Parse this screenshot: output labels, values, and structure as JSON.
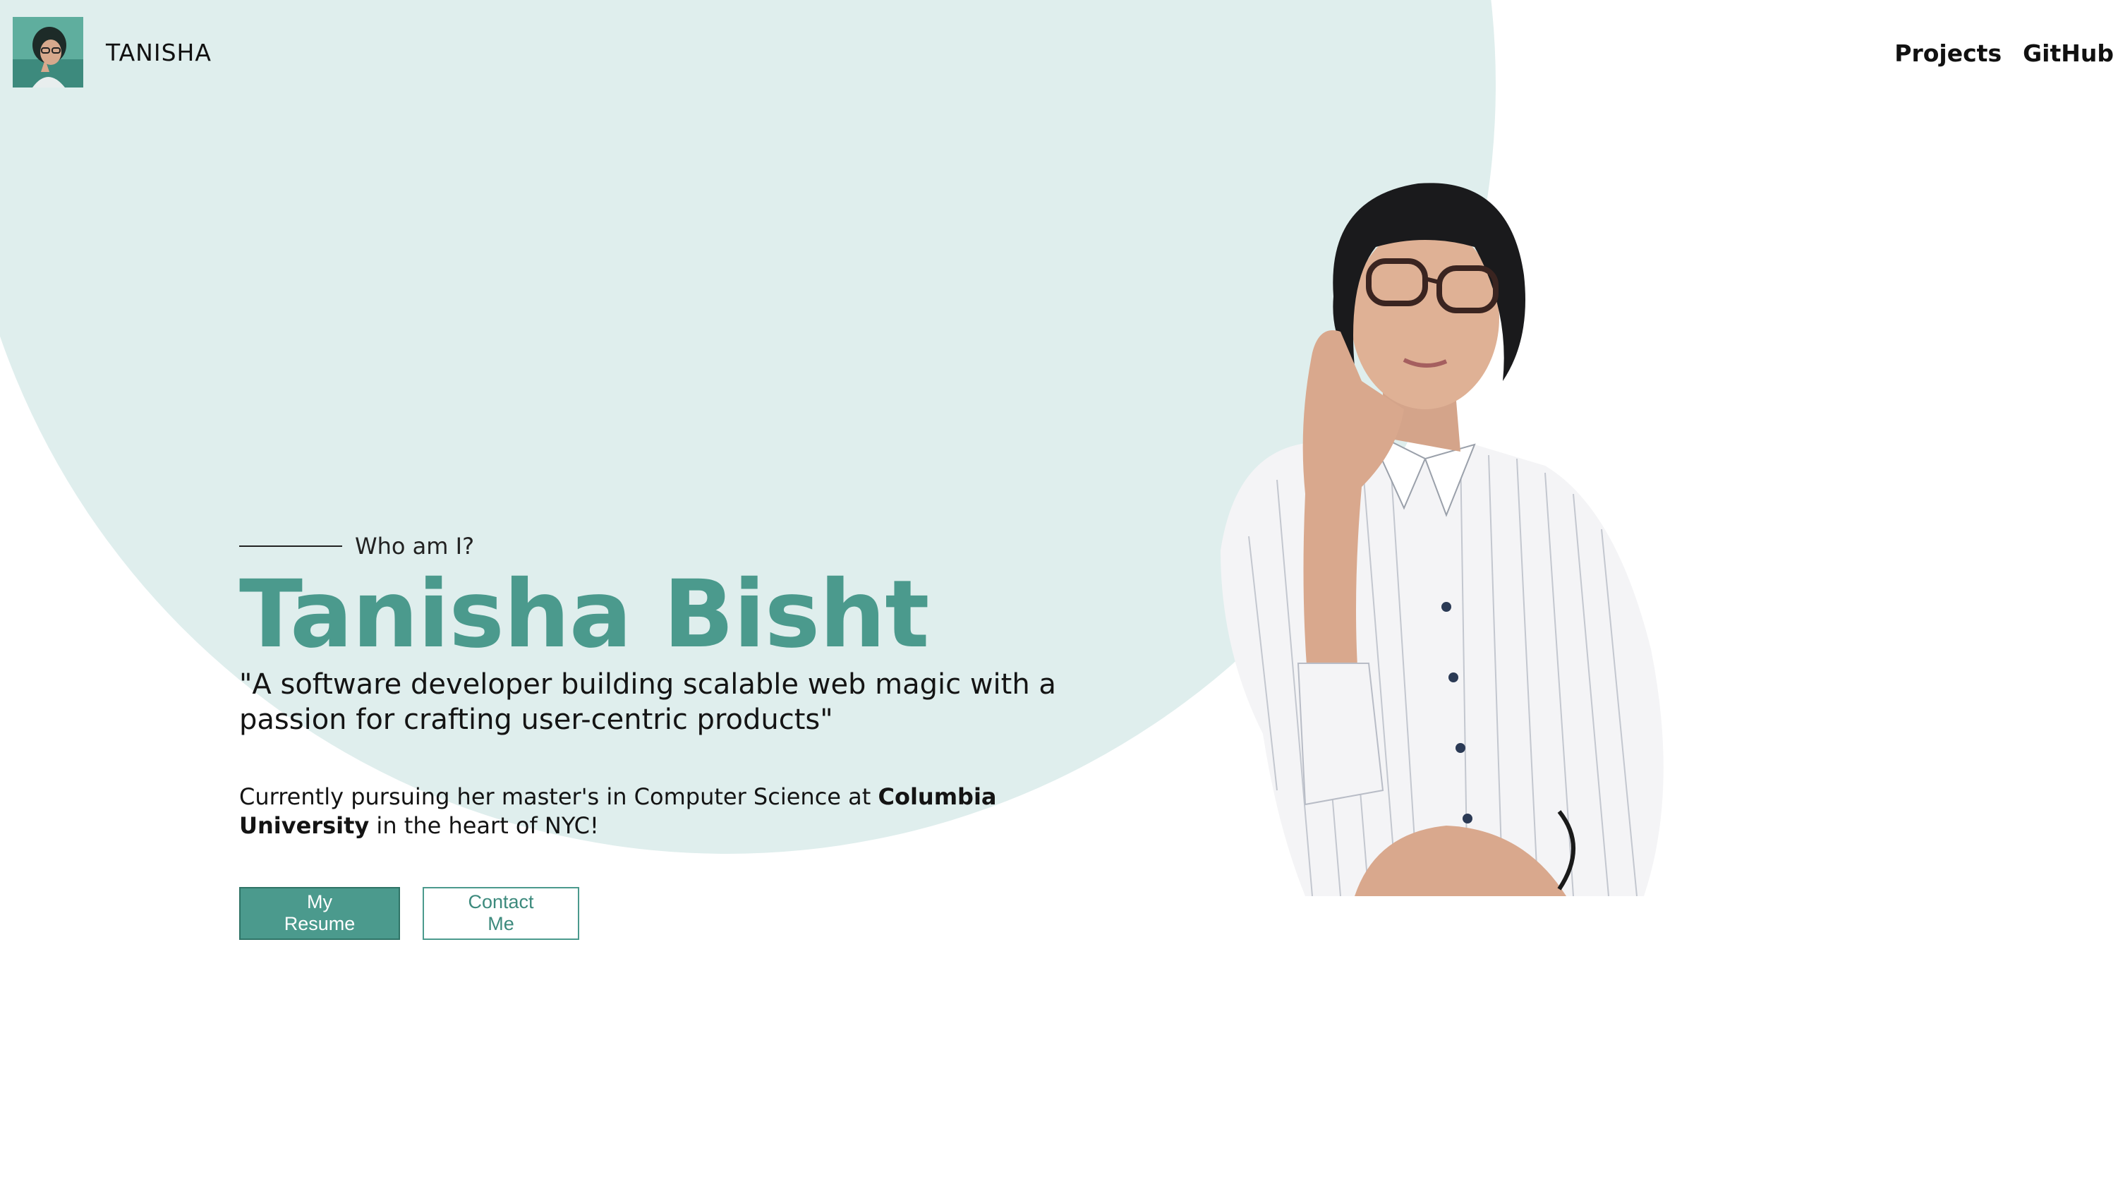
{
  "header": {
    "brand": "TANISHA",
    "avatar_alt": "avatar",
    "nav": {
      "projects": "Projects",
      "github": "GitHub"
    }
  },
  "hero": {
    "eyebrow": "Who am I?",
    "name": "Tanisha Bisht",
    "tagline": "\"A software developer building scalable web magic with a passion for crafting user-centric products\"",
    "bio_before": "Currently pursuing her master's in Computer Science at ",
    "bio_bold": "Columbia University",
    "bio_after": " in the heart of NYC!",
    "buttons": {
      "resume": "My Resume",
      "contact": "Contact Me"
    }
  },
  "colors": {
    "accent": "#4b9a8d",
    "circle_bg": "#dfeeed",
    "text": "#111111"
  },
  "icons": {
    "portrait": "person-photo",
    "avatar": "avatar-photo"
  }
}
